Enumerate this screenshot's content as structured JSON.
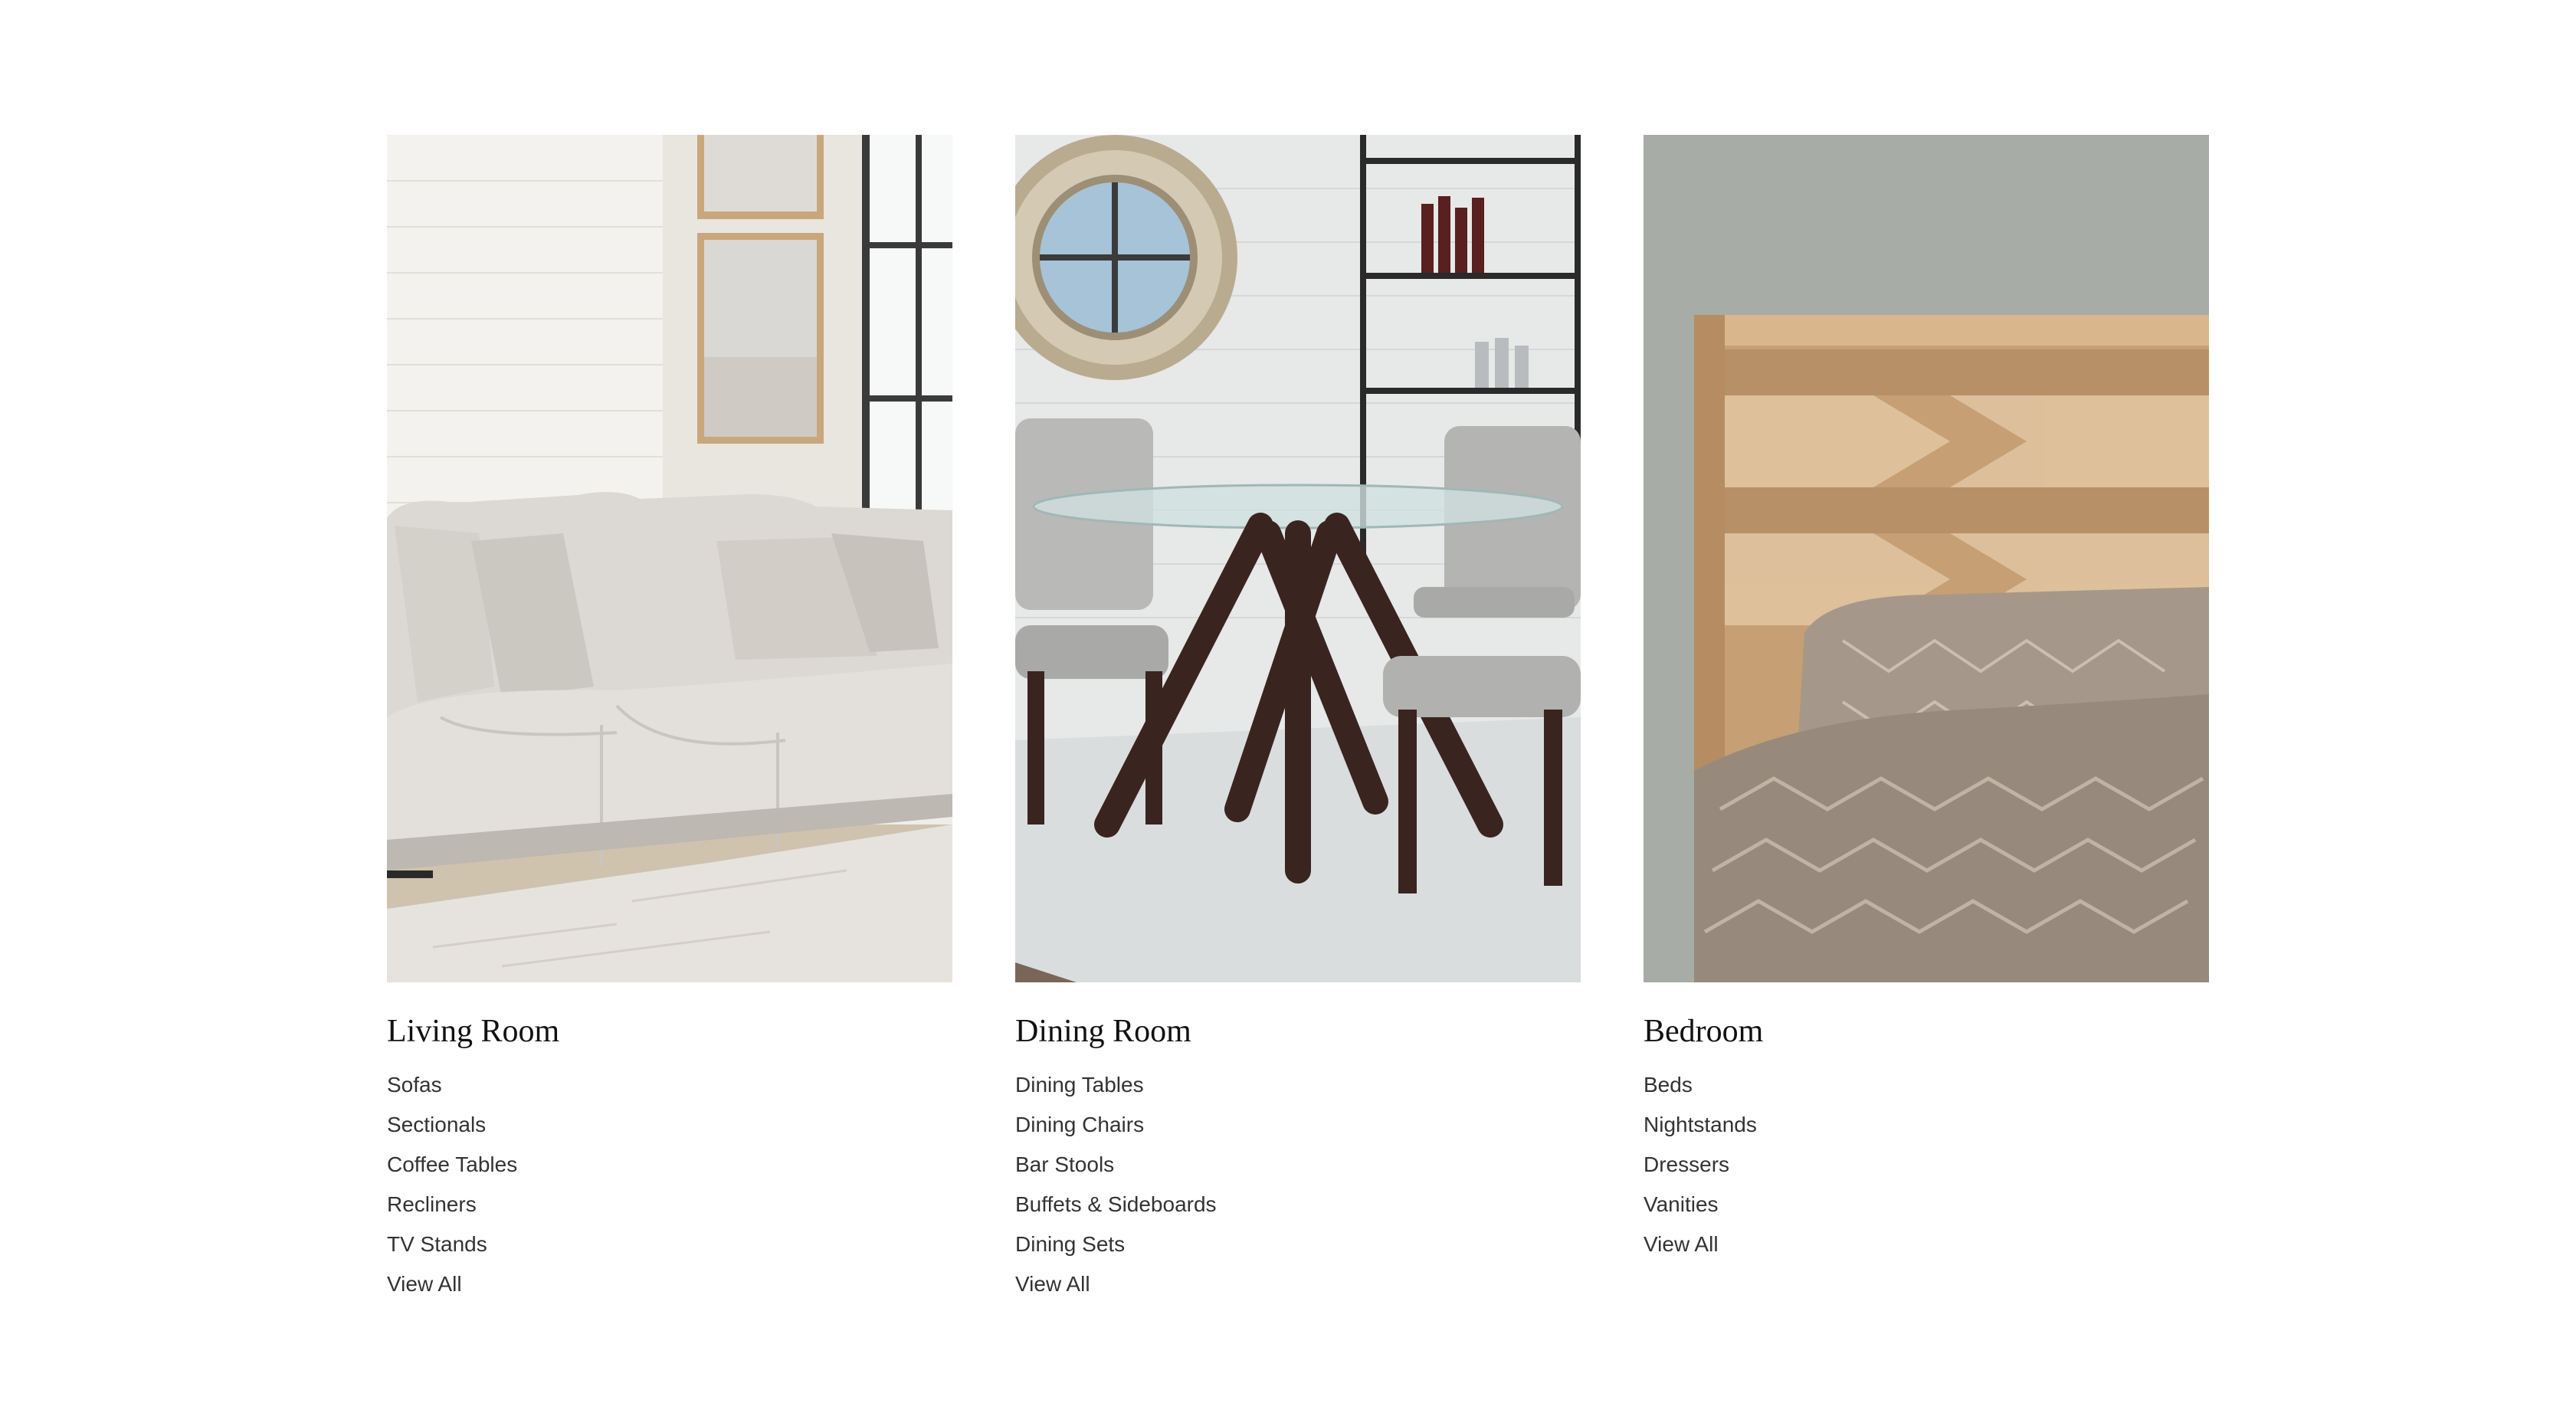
{
  "categories": [
    {
      "title": "Living Room",
      "image_alt": "Light gray sectional sofa with pillows in a bright living room",
      "links": [
        "Sofas",
        "Sectionals",
        "Coffee Tables",
        "Recliners",
        "TV Stands",
        "View All"
      ]
    },
    {
      "title": "Dining Room",
      "image_alt": "Round glass dining table with dark wood base and gray upholstered chairs",
      "links": [
        "Dining Tables",
        "Dining Chairs",
        "Bar Stools",
        "Buffets & Sideboards",
        "Dining Sets",
        "View All"
      ]
    },
    {
      "title": "Bedroom",
      "image_alt": "Light wood chevron headboard with taupe quilted bedding",
      "links": [
        "Beds",
        "Nightstands",
        "Dressers",
        "Vanities",
        "View All"
      ]
    }
  ]
}
